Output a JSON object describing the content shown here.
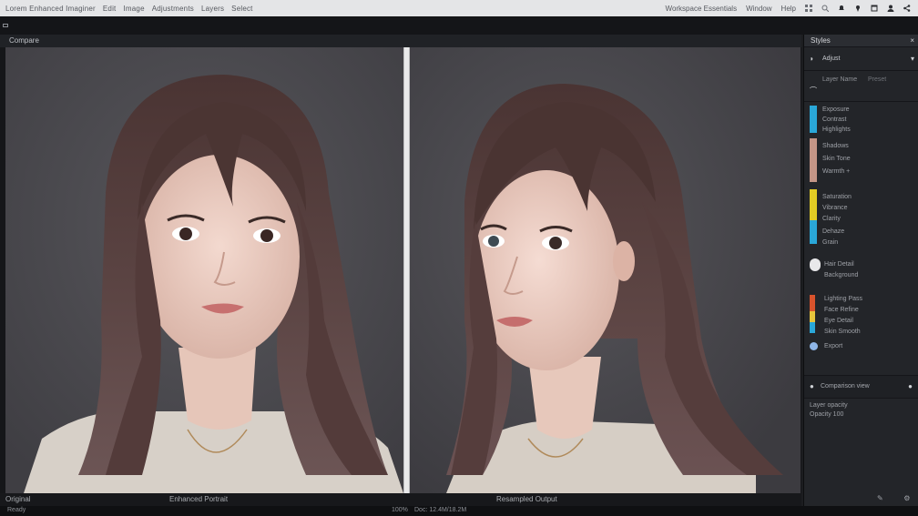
{
  "menubar": {
    "items": [
      "Lorem Enhanced Imaginer",
      "Edit",
      "Image",
      "Adjustments",
      "Layers",
      "Select"
    ],
    "right_items": [
      "Workspace Essentials",
      "Window",
      "Help"
    ]
  },
  "viewer": {
    "tab_title": "Compare",
    "footer_left": "Original",
    "footer_mid": "Enhanced Portrait",
    "footer_right": "Resampled Output"
  },
  "statusbar": {
    "left": "Ready",
    "mid": "100%",
    "right": "Doc: 12.4M/18.2M"
  },
  "panel": {
    "title": "Styles",
    "close_icon": "×",
    "section1_label": "Adjust",
    "section1_sub": "Layer Name",
    "section1_hint": "Preset",
    "blocks": [
      {
        "color": "#2aa7d8",
        "lines": [
          "Exposure",
          "Contrast",
          "Highlights"
        ]
      },
      {
        "color": "#c49586",
        "lines": [
          "Shadows",
          "Skin Tone",
          "Warmth +"
        ]
      },
      {
        "color": "#e2cc24",
        "lines": [
          "Saturation",
          "Vibrance",
          "Clarity"
        ]
      },
      {
        "color": "#2aa7d8",
        "lines": [
          "Dehaze",
          "Grain"
        ]
      }
    ],
    "group2_lines": [
      "Hair Detail",
      "Background",
      "Lighting Pass",
      "Face Refine",
      "Eye Detail",
      "Skin Smooth",
      "Export"
    ],
    "group2_colors": [
      "#d9532c",
      "#e6c43c",
      "#2aa7d8"
    ],
    "footer_lines": [
      "Comparison view",
      "Layer opacity",
      "Opacity 100"
    ]
  }
}
